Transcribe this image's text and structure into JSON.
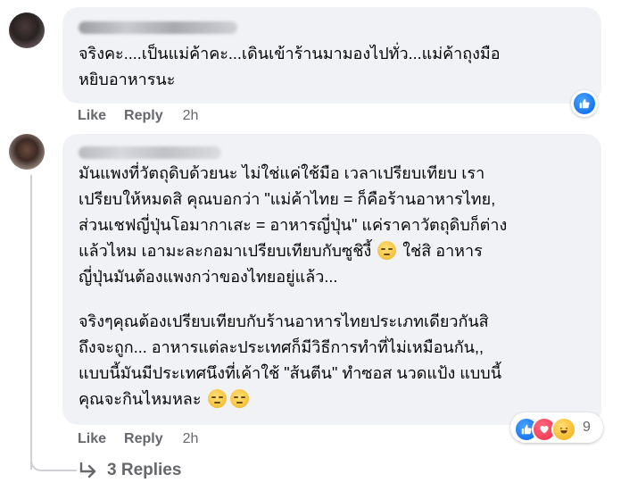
{
  "comment1": {
    "text": "จริงคะ....เป็นแม่ค้าคะ...เดินเข้าร้านมามองไปทั่ว...แม่ค้าถุงมือ\nหยิบอาหารนะ",
    "actions": {
      "like": "Like",
      "reply": "Reply",
      "time": "2h"
    },
    "reaction_icon": "like-icon"
  },
  "comment2": {
    "paragraph1_before_emoji": "มันแพงที่วัตถุดิบด้วยนะ ไม่ใช่แค่ใช้มือ เวลาเปรียบเทียบ เรา\nเปรียบให้หมดสิ คุณบอกว่า \"แม่ค้าไทย = ก็คือร้านอาหารไทย,\nส่วนเชฟญี่ปุ่นโอมากาเสะ = อาหารญี่ปุ่น\" แค่ราคาวัตถุดิบก็ต่าง\nแล้วไหม เอามะละกอมาเปรียบเทียบกับซูชิงี้ ",
    "paragraph1_after_emoji": " ใช่สิ อาหาร\nญี่ปุ่นมันต้องแพงกว่าของไทยอยู่แล้ว...",
    "paragraph2": "จริงๆคุณต้องเปรียบเทียบกับร้านอาหารไทยประเภทเดียวกันสิ\nถึงจะถูก... อาหารแต่ละประเทศก็มีวิธีการทำที่ไม่เหมือนกัน,,\nแบบนี้มันมีประเทศนึงที่เค้าใช้ \"ส้นตีน\" ทำซอส นวดแป้ง แบบนี้\nคุณจะกินไหมหละ ",
    "actions": {
      "like": "Like",
      "reply": "Reply",
      "time": "2h"
    },
    "reactions": {
      "icons": [
        "like-icon",
        "love-icon",
        "haha-icon"
      ],
      "count": "9"
    },
    "emoji_icon": "unamused-face-emoji"
  },
  "replies": {
    "label": "3 Replies"
  },
  "colors": {
    "bubble": "#f0f2f5",
    "secondary_text": "#65676b",
    "like_blue": "#1877f2",
    "love_red": "#f33e58",
    "haha_yellow": "#f7b928"
  }
}
